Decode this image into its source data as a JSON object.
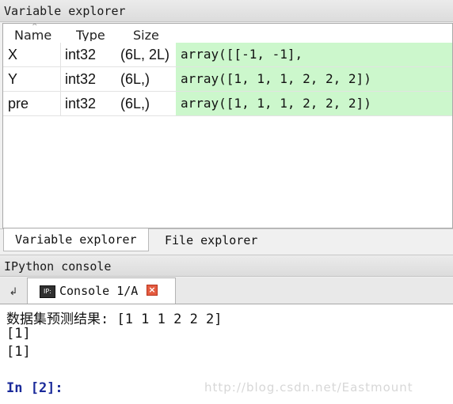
{
  "variable_explorer": {
    "title": "Variable explorer",
    "columns": {
      "name": "Name",
      "type": "Type",
      "size": "Size"
    },
    "rows": [
      {
        "name": "X",
        "type": "int32",
        "size": "(6L, 2L)",
        "value": "array([[-1, -1],"
      },
      {
        "name": "Y",
        "type": "int32",
        "size": "(6L,)",
        "value": "array([1, 1, 1, 2, 2, 2])"
      },
      {
        "name": "pre",
        "type": "int32",
        "size": "(6L,)",
        "value": "array([1, 1, 1, 2, 2, 2])"
      }
    ],
    "value_bg": "#ccf7cc"
  },
  "bottom_tabs": [
    {
      "label": "Variable explorer",
      "active": true
    },
    {
      "label": "File explorer",
      "active": false
    }
  ],
  "ipython": {
    "title": "IPython console",
    "tab_label": "Console 1/A",
    "icon_text": "IP:",
    "output_lines": [
      "数据集预测结果: [1 1 1 2 2 2]",
      "[1]",
      "[1]"
    ],
    "prompt": "In [2]:",
    "watermark": "http://blog.csdn.net/Eastmount"
  }
}
